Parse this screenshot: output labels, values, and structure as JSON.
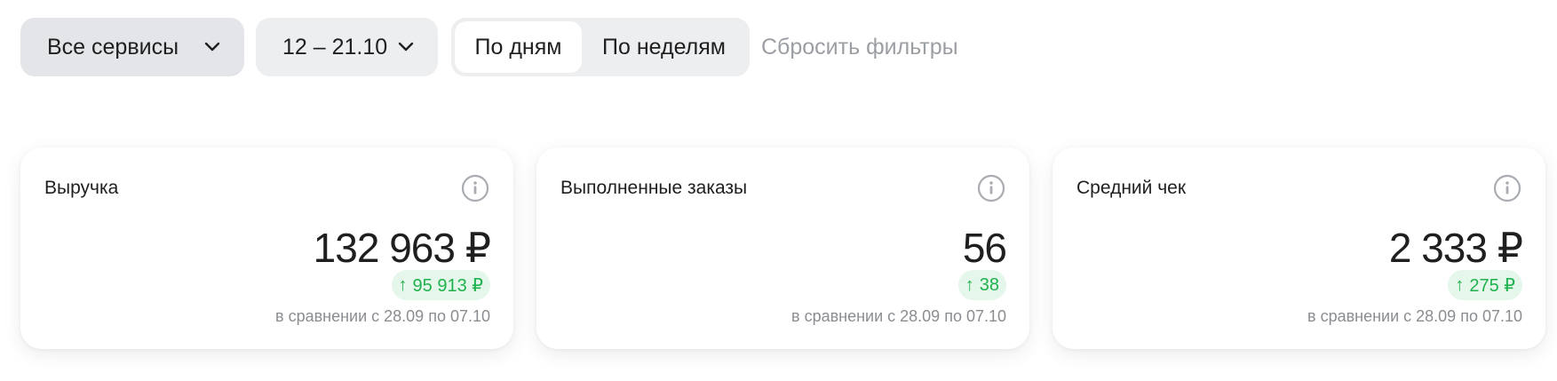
{
  "filters": {
    "services_label": "Все сервисы",
    "dates_label": "12 – 21.10",
    "by_days_label": "По дням",
    "by_weeks_label": "По неделям",
    "reset_label": "Сбросить фильтры",
    "icons": [
      "chevron-down-icon"
    ],
    "active_period": "by_days"
  },
  "cards": [
    {
      "title": "Выручка",
      "value": "132 963 ₽",
      "delta": "95 913 ₽",
      "compare": "в сравнении с 28.09 по 07.10"
    },
    {
      "title": "Выполненные заказы",
      "value": "56",
      "delta": "38",
      "compare": "в сравнении с 28.09 по 07.10"
    },
    {
      "title": "Средний чек",
      "value": "2 333 ₽",
      "delta": "275 ₽",
      "compare": "в сравнении с 28.09 по 07.10"
    }
  ],
  "colors": {
    "positive": "#1fb14d",
    "positive_bg": "#e4f7ea",
    "muted_text": "#8a8d91",
    "select_bg": "#e3e5e8"
  }
}
